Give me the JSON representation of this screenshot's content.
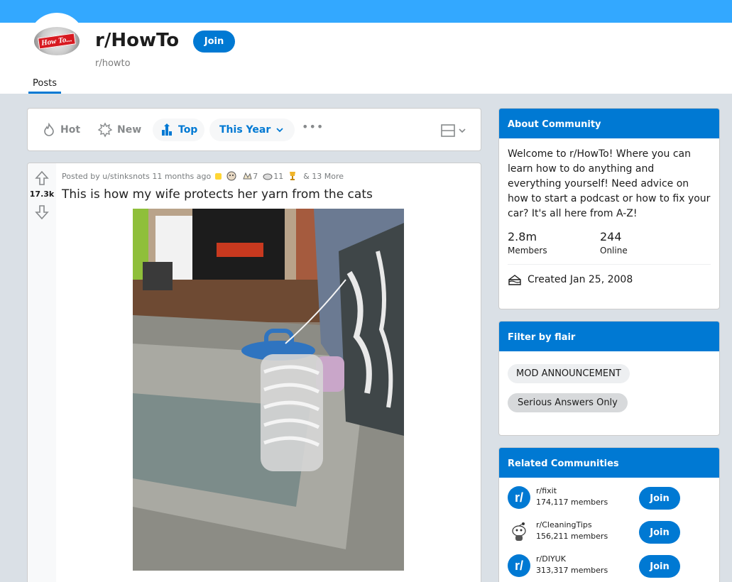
{
  "header": {
    "logo_text": "How To...",
    "title": "r/HowTo",
    "subname": "r/howto",
    "join_label": "Join",
    "tab_posts": "Posts"
  },
  "sort": {
    "hot": "Hot",
    "new": "New",
    "top": "Top",
    "period": "This Year",
    "more": "•••"
  },
  "post": {
    "votes": "17.3k",
    "posted_by": "Posted by u/stinksnots 11 months ago",
    "award_count_1": "7",
    "award_count_2": "11",
    "more_awards": "& 13 More",
    "title": "This is how my wife protects her yarn from the cats"
  },
  "about": {
    "heading": "About Community",
    "description": "Welcome to r/HowTo! Where you can learn how to do anything and everything yourself! Need advice on how to start a podcast or how to fix your car? It's all here from A-Z!",
    "members_count": "2.8m",
    "members_label": "Members",
    "online_count": "244",
    "online_label": "Online",
    "created": "Created Jan 25, 2008"
  },
  "flair": {
    "heading": "Filter by flair",
    "items": [
      "MOD ANNOUNCEMENT",
      "Serious Answers Only"
    ]
  },
  "related": {
    "heading": "Related Communities",
    "join_label": "Join",
    "items": [
      {
        "name": "r/fixit",
        "members": "174,117 members",
        "avatar": "r/"
      },
      {
        "name": "r/CleaningTips",
        "members": "156,211 members",
        "avatar": ""
      },
      {
        "name": "r/DIYUK",
        "members": "313,317 members",
        "avatar": "r/"
      }
    ]
  },
  "colors": {
    "accent": "#0079d3",
    "topbar": "#33a8ff",
    "background": "#dae0e6"
  }
}
